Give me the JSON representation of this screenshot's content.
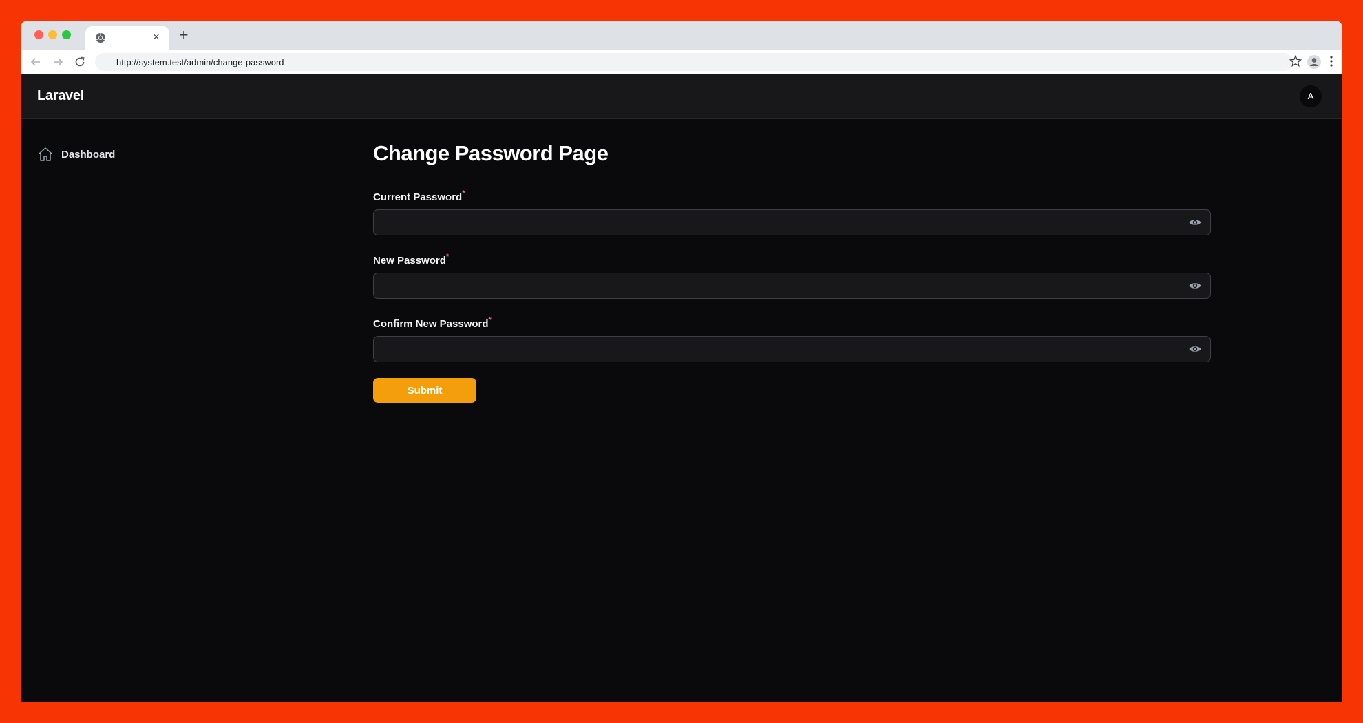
{
  "browser": {
    "tab_title": "",
    "url": "http://system.test/admin/change-password",
    "new_tab_symbol": "+",
    "close_symbol": "×"
  },
  "app": {
    "brand": "Laravel",
    "avatar_initial": "A"
  },
  "sidebar": {
    "items": [
      {
        "label": "Dashboard",
        "icon": "home-icon"
      }
    ]
  },
  "page": {
    "title": "Change Password Page",
    "fields": [
      {
        "label": "Current Password",
        "required_mark": "*",
        "value": "",
        "icon": "eye-icon"
      },
      {
        "label": "New Password",
        "required_mark": "*",
        "value": "",
        "icon": "eye-icon"
      },
      {
        "label": "Confirm New Password",
        "required_mark": "*",
        "value": "",
        "icon": "eye-icon"
      }
    ],
    "submit_label": "Submit"
  },
  "colors": {
    "frame": "#f73504",
    "accent": "#f59e0b",
    "required": "#f87171",
    "background": "#0a0a0c"
  }
}
